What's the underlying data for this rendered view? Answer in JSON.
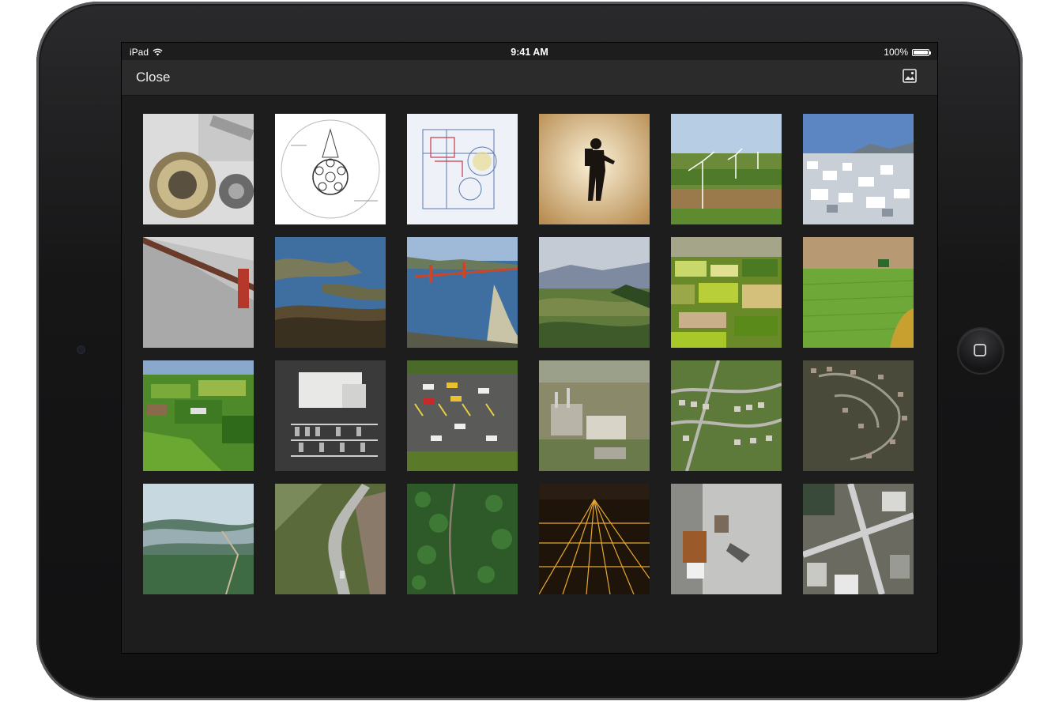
{
  "status_bar": {
    "carrier": "iPad",
    "time": "9:41 AM",
    "battery": "100%",
    "battery_level": 1.0
  },
  "nav_bar": {
    "close_label": "Close",
    "right_icon": "image-icon"
  },
  "grid": {
    "columns": 6,
    "rows": 4
  },
  "thumbnails": [
    {
      "name": "thumb-gears",
      "subject": "gears"
    },
    {
      "name": "thumb-technical-drawing",
      "subject": "drawing"
    },
    {
      "name": "thumb-engine-blueprint",
      "subject": "blueprint"
    },
    {
      "name": "thumb-astronaut-silhouette",
      "subject": "silhouette"
    },
    {
      "name": "thumb-wind-turbines",
      "subject": "turbines"
    },
    {
      "name": "thumb-city-hillside",
      "subject": "city"
    },
    {
      "name": "thumb-bridge-aerial",
      "subject": "bridge"
    },
    {
      "name": "thumb-bay-aerial",
      "subject": "bay"
    },
    {
      "name": "thumb-golden-gate-bridge",
      "subject": "goldengate"
    },
    {
      "name": "thumb-hills-valley",
      "subject": "valley"
    },
    {
      "name": "thumb-farm-fields",
      "subject": "fields"
    },
    {
      "name": "thumb-green-field-tractor",
      "subject": "tractor"
    },
    {
      "name": "thumb-farmland-aerial",
      "subject": "farmland"
    },
    {
      "name": "thumb-building-parking-lot",
      "subject": "parking"
    },
    {
      "name": "thumb-highway-traffic",
      "subject": "highway"
    },
    {
      "name": "thumb-industrial-plant",
      "subject": "industrial"
    },
    {
      "name": "thumb-suburb-houses",
      "subject": "suburb"
    },
    {
      "name": "thumb-suburb-dense",
      "subject": "suburb2"
    },
    {
      "name": "thumb-misty-forest",
      "subject": "mist"
    },
    {
      "name": "thumb-mountain-road",
      "subject": "road"
    },
    {
      "name": "thumb-forest-path",
      "subject": "forest"
    },
    {
      "name": "thumb-city-night-lights",
      "subject": "night"
    },
    {
      "name": "thumb-rooftop-terrace",
      "subject": "terrace"
    },
    {
      "name": "thumb-city-intersection",
      "subject": "intersection"
    }
  ]
}
